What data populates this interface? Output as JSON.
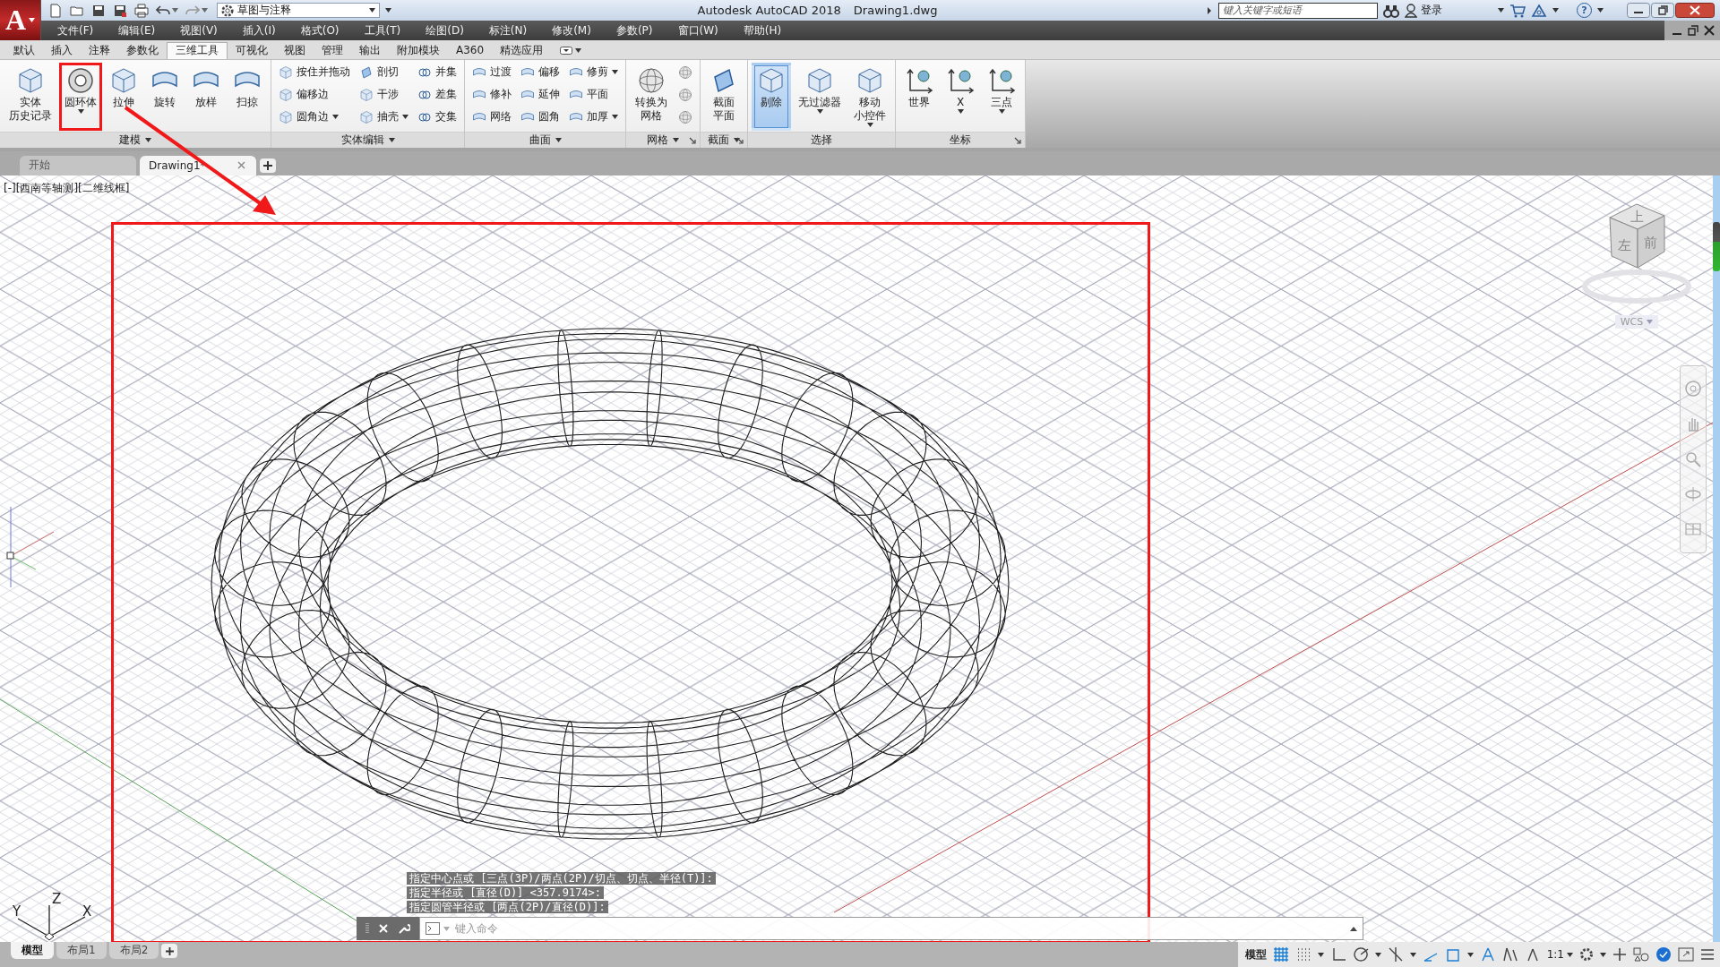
{
  "title_bar": {
    "logo": "A",
    "workspace": "草图与注释",
    "app_title": "Autodesk AutoCAD 2018",
    "file_name": "Drawing1.dwg",
    "search": {
      "placeholder": "键入关键字或短语"
    },
    "sign_in": "登录",
    "help": "?"
  },
  "menu_bar": [
    "文件(F)",
    "编辑(E)",
    "视图(V)",
    "插入(I)",
    "格式(O)",
    "工具(T)",
    "绘图(D)",
    "标注(N)",
    "修改(M)",
    "参数(P)",
    "窗口(W)",
    "帮助(H)"
  ],
  "ribbon": {
    "tabs": [
      {
        "label": "默认",
        "selected": false
      },
      {
        "label": "插入",
        "selected": false
      },
      {
        "label": "注释",
        "selected": false
      },
      {
        "label": "参数化",
        "selected": false
      },
      {
        "label": "三维工具",
        "selected": true
      },
      {
        "label": "可视化",
        "selected": false
      },
      {
        "label": "视图",
        "selected": false
      },
      {
        "label": "管理",
        "selected": false
      },
      {
        "label": "输出",
        "selected": false
      },
      {
        "label": "附加模块",
        "selected": false
      },
      {
        "label": "A360",
        "selected": false
      },
      {
        "label": "精选应用",
        "selected": false
      }
    ],
    "panels": [
      {
        "title": "建模",
        "menu": true,
        "launcher": false,
        "items": [
          {
            "kind": "large",
            "lines": [
              "实体",
              "历史记录"
            ],
            "dropdown": false,
            "active": false,
            "highlighted": false
          },
          {
            "kind": "large",
            "lines": [
              "圆环体"
            ],
            "dropdown": true,
            "active": false,
            "highlighted": true
          },
          {
            "kind": "large",
            "lines": [
              "拉伸"
            ],
            "dropdown": false,
            "active": false,
            "highlighted": false
          },
          {
            "kind": "large",
            "lines": [
              "旋转"
            ],
            "dropdown": false,
            "active": false,
            "highlighted": false
          },
          {
            "kind": "large",
            "lines": [
              "放样"
            ],
            "dropdown": false,
            "active": false,
            "highlighted": false
          },
          {
            "kind": "large",
            "lines": [
              "扫掠"
            ],
            "dropdown": false,
            "active": false,
            "highlighted": false
          }
        ]
      },
      {
        "title": "实体编辑",
        "menu": true,
        "launcher": false,
        "items": [
          {
            "kind": "column",
            "buttons": [
              {
                "label": "按住并拖动",
                "dropdown": false
              },
              {
                "label": "偏移边",
                "dropdown": false
              },
              {
                "label": "圆角边",
                "dropdown": true
              }
            ]
          },
          {
            "kind": "column",
            "buttons": [
              {
                "label": "剖切",
                "dropdown": false
              },
              {
                "label": "干涉",
                "dropdown": false
              },
              {
                "label": "抽壳",
                "dropdown": true
              }
            ]
          },
          {
            "kind": "column",
            "buttons": [
              {
                "label": "并集",
                "dropdown": false
              },
              {
                "label": "差集",
                "dropdown": false
              },
              {
                "label": "交集",
                "dropdown": false
              }
            ]
          }
        ]
      },
      {
        "title": "曲面",
        "menu": true,
        "launcher": false,
        "items": [
          {
            "kind": "column",
            "buttons": [
              {
                "label": "过渡",
                "dropdown": false
              },
              {
                "label": "修补",
                "dropdown": false
              },
              {
                "label": "网络",
                "dropdown": false
              }
            ]
          },
          {
            "kind": "column",
            "buttons": [
              {
                "label": "偏移",
                "dropdown": false
              },
              {
                "label": "延伸",
                "dropdown": false
              },
              {
                "label": "圆角",
                "dropdown": false
              }
            ]
          },
          {
            "kind": "column",
            "buttons": [
              {
                "label": "修剪",
                "dropdown": true
              },
              {
                "label": "平面",
                "dropdown": false
              },
              {
                "label": "加厚",
                "dropdown": true
              }
            ]
          }
        ]
      },
      {
        "title": "网格",
        "menu": true,
        "launcher": true,
        "items": [
          {
            "kind": "large",
            "lines": [
              "转换为",
              "网格"
            ],
            "dropdown": false,
            "active": false,
            "highlighted": false
          },
          {
            "kind": "column",
            "buttons": [
              {
                "dropdown": false
              },
              {
                "dropdown": false
              },
              {
                "dropdown": false
              }
            ]
          }
        ]
      },
      {
        "title": "截面",
        "menu": true,
        "launcher": true,
        "items": [
          {
            "kind": "large",
            "lines": [
              "截面",
              "平面"
            ],
            "dropdown": false,
            "active": false,
            "highlighted": false
          }
        ]
      },
      {
        "title": "选择",
        "menu": false,
        "launcher": false,
        "items": [
          {
            "kind": "large",
            "lines": [
              "剔除"
            ],
            "dropdown": false,
            "active": true,
            "highlighted": false
          },
          {
            "kind": "large",
            "lines": [
              "无过滤器"
            ],
            "dropdown": true,
            "active": false,
            "highlighted": false
          },
          {
            "kind": "large",
            "lines": [
              "移动",
              "小控件"
            ],
            "dropdown": true,
            "active": false,
            "highlighted": false
          }
        ]
      },
      {
        "title": "坐标",
        "menu": false,
        "launcher": true,
        "items": [
          {
            "kind": "large",
            "lines": [
              "世界"
            ],
            "dropdown": false,
            "active": false,
            "highlighted": false
          },
          {
            "kind": "large",
            "lines": [
              "X"
            ],
            "dropdown": true,
            "active": false,
            "highlighted": false
          },
          {
            "kind": "large",
            "lines": [
              "三点"
            ],
            "dropdown": true,
            "active": false,
            "highlighted": false
          }
        ]
      }
    ]
  },
  "document_tabs": [
    {
      "label": "开始",
      "selected": false,
      "closable": false
    },
    {
      "label": "Drawing1*",
      "selected": true,
      "closable": true
    }
  ],
  "viewport": {
    "label": "[-][西南等轴测][二维线框]",
    "viewcube": {
      "top": "上",
      "left": "左",
      "front": "前"
    },
    "ucs_menu": "WCS",
    "ucs_axes": {
      "x": "X",
      "y": "Y",
      "z": "Z"
    }
  },
  "command_line": {
    "history": [
      "指定中心点或 [三点(3P)/两点(2P)/切点、切点、半径(T)]:",
      "指定半径或 [直径(D)] <357.9174>:",
      "指定圆管半径或 [两点(2P)/直径(D)]:"
    ],
    "placeholder": "键入命令"
  },
  "layout_tabs": [
    {
      "label": "模型",
      "selected": true
    },
    {
      "label": "布局1",
      "selected": false
    },
    {
      "label": "布局2",
      "selected": false
    }
  ],
  "status_bar": {
    "space": "模型",
    "toggles": [
      {
        "on": true
      },
      {
        "on": false
      },
      {
        "on": false
      },
      {
        "on": false
      },
      {
        "on": false
      },
      {
        "on": true
      },
      {
        "on": true
      },
      {
        "on": true
      },
      {
        "on": false
      },
      {
        "on": false
      }
    ],
    "scale": "1:1"
  }
}
